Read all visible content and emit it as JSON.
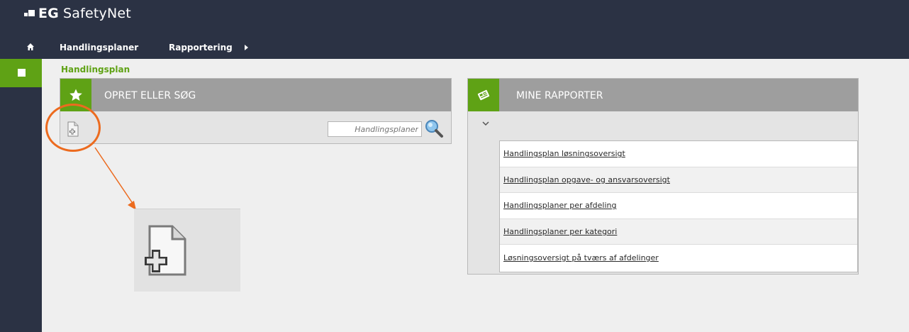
{
  "app": {
    "brand": "EG",
    "name": "SafetyNet"
  },
  "nav": {
    "items": [
      {
        "label": "Handlingsplaner"
      },
      {
        "label": "Rapportering"
      }
    ]
  },
  "page": {
    "title": "Handlingsplan"
  },
  "panels": {
    "create_search": {
      "title": "OPRET ELLER SØG",
      "search_placeholder": "Handlingsplaner",
      "icon": "star-icon"
    },
    "my_reports": {
      "title": "MINE RAPPORTER",
      "icon": "newspaper-icon",
      "reports": [
        "Handlingsplan løsningsoversigt",
        "Handlingsplan opgave- og ansvarsoversigt",
        "Handlingsplaner per afdeling",
        "Handlingsplaner per kategori",
        "Løsningsoversigt på tværs af afdelinger"
      ]
    }
  },
  "colors": {
    "topbar": "#2b3244",
    "accent_green": "#5fa215",
    "panel_header": "#9e9e9e",
    "callout_orange": "#ec6b1f"
  }
}
